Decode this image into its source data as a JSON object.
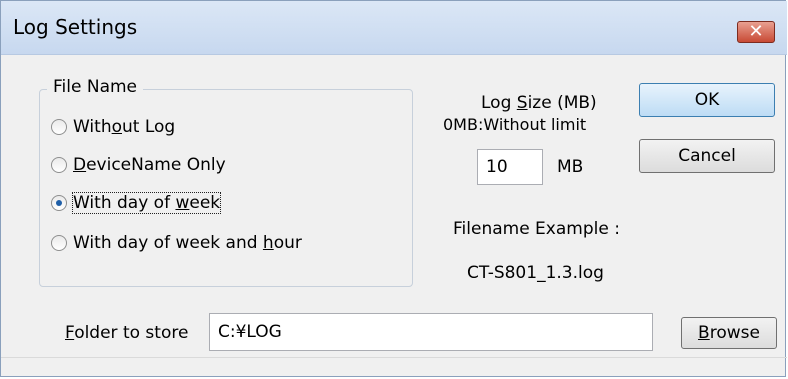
{
  "window": {
    "title": "Log Settings",
    "close_glyph": "✕"
  },
  "file_name": {
    "legend": "File Name",
    "options": [
      {
        "pre": "With",
        "mnemonic": "o",
        "post": "ut Log",
        "selected": false
      },
      {
        "pre": "",
        "mnemonic": "D",
        "post": "eviceName Only",
        "selected": false
      },
      {
        "pre": "With day of ",
        "mnemonic": "w",
        "post": "eek",
        "selected": true
      },
      {
        "pre": "With day of week and ",
        "mnemonic": "h",
        "post": "our",
        "selected": false
      }
    ]
  },
  "log_size": {
    "label_pre": "Log ",
    "label_mnemonic": "S",
    "label_post": "ize (MB)",
    "hint": "0MB:Without limit",
    "value": "10",
    "unit": "MB"
  },
  "filename_example": {
    "label": "Filename Example :",
    "value": "CT-S801_1.3.log"
  },
  "folder": {
    "label_mnemonic": "F",
    "label_post": "older to store",
    "value": "C:¥LOG"
  },
  "buttons": {
    "ok": "OK",
    "cancel": "Cancel",
    "browse_mnemonic": "B",
    "browse_post": "rowse"
  },
  "colors": {
    "title_bar": "#c7d8ef",
    "close_button": "#c84a35",
    "default_button": "#bddcf5",
    "selected_radio": "#1f5fa8"
  }
}
